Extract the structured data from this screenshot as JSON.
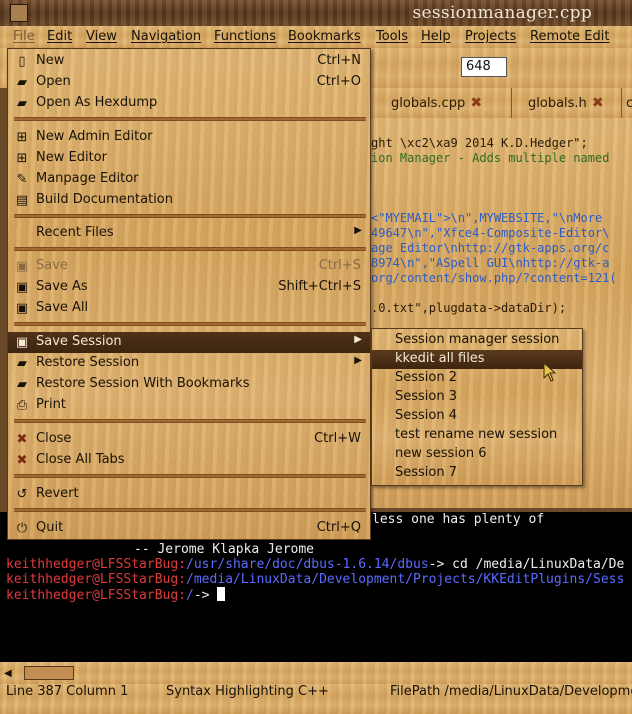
{
  "window": {
    "title": "sessionmanager.cpp"
  },
  "menubar": {
    "items": [
      "File",
      "Edit",
      "View",
      "Navigation",
      "Functions",
      "Bookmarks",
      "Tools",
      "Help",
      "Projects",
      "Remote Edit"
    ]
  },
  "toolbar": {
    "line_number": "648"
  },
  "tabs": [
    {
      "label": "globals.cpp"
    },
    {
      "label": "globals.h"
    },
    {
      "label": "c"
    }
  ],
  "editor": {
    "lines": [
      {
        "text": "ght \\xc2\\xa9 2014 K.D.Hedger\";",
        "kind": "def"
      },
      {
        "text": "ion Manager - Adds multiple named",
        "kind": "com"
      },
      {
        "text": "<\"MYEMAIL\">\\n\",MYWEBSITE,\"\\nMore",
        "kind": "str"
      },
      {
        "text": "49647\\n\",\"Xfce4-Composite-Editor\\",
        "kind": "str"
      },
      {
        "text": "age Editor\\nhttp://gtk-apps.org/c",
        "kind": "str"
      },
      {
        "text": "8974\\n\",\"ASpell GUI\\nhttp://gtk-a",
        "kind": "str"
      },
      {
        "text": "org/content/show.php/?content=121(",
        "kind": "str"
      },
      {
        "text": ".0.txt\",plugdata->dataDir);",
        "kind": "def"
      }
    ]
  },
  "file_menu": {
    "items": [
      {
        "label": "New",
        "accel": "Ctrl+N",
        "icon": "new-document-icon",
        "glyph": "▯"
      },
      {
        "label": "Open",
        "accel": "Ctrl+O",
        "icon": "open-folder-icon",
        "glyph": "▰"
      },
      {
        "label": "Open As Hexdump",
        "accel": "",
        "icon": "open-folder-icon",
        "glyph": "▰"
      },
      {
        "label": "New Admin Editor",
        "accel": "",
        "icon": "admin-editor-icon",
        "glyph": "⊞"
      },
      {
        "label": "New Editor",
        "accel": "",
        "icon": "editor-icon",
        "glyph": "⊞"
      },
      {
        "label": "Manpage Editor",
        "accel": "",
        "icon": "manpage-editor-icon",
        "glyph": "✎"
      },
      {
        "label": "Build Documentation",
        "accel": "",
        "icon": "documentation-icon",
        "glyph": "▤"
      },
      {
        "label": "Recent Files",
        "accel": "",
        "icon": "",
        "glyph": ""
      },
      {
        "label": "Save",
        "accel": "Ctrl+S",
        "icon": "save-icon",
        "glyph": "▣"
      },
      {
        "label": "Save As",
        "accel": "Shift+Ctrl+S",
        "icon": "save-as-icon",
        "glyph": "▣"
      },
      {
        "label": "Save All",
        "accel": "",
        "icon": "save-all-icon",
        "glyph": "▣"
      },
      {
        "label": "Save Session",
        "accel": "",
        "icon": "save-session-icon",
        "glyph": "▣"
      },
      {
        "label": "Restore Session",
        "accel": "",
        "icon": "restore-session-icon",
        "glyph": "▰"
      },
      {
        "label": "Restore Session With Bookmarks",
        "accel": "",
        "icon": "restore-bookmarks-icon",
        "glyph": "▰"
      },
      {
        "label": "Print",
        "accel": "",
        "icon": "print-icon",
        "glyph": "⎙"
      },
      {
        "label": "Close",
        "accel": "Ctrl+W",
        "icon": "close-icon",
        "glyph": "✖"
      },
      {
        "label": "Close All Tabs",
        "accel": "",
        "icon": "close-all-icon",
        "glyph": "✖"
      },
      {
        "label": "Revert",
        "accel": "",
        "icon": "revert-icon",
        "glyph": "↺"
      },
      {
        "label": "Quit",
        "accel": "Ctrl+Q",
        "icon": "quit-icon",
        "glyph": "⏻"
      }
    ]
  },
  "session_submenu": {
    "items": [
      "Session manager session",
      "kkedit all files",
      "Session 2",
      "Session 3",
      "Session 4",
      "test rename new session",
      "new session 6",
      "Session 7"
    ],
    "selected": "kkedit all files"
  },
  "terminal": {
    "lines": [
      {
        "user": "",
        "path": "",
        "rest": "less one has plenty of"
      },
      {
        "user": "",
        "path": "",
        "rest": "-- Jerome Klapka Jerome"
      },
      {
        "user": "keithhedger@LFSStarBug",
        "path": "/usr/share/doc/dbus-1.6.14/dbus",
        "rest": "-> cd /media/LinuxData/De"
      },
      {
        "user": "keithhedger@LFSStarBug",
        "path": "/media/LinuxData/Development/Projects/KKEditPlugins/Sess",
        "rest": ""
      },
      {
        "user": "keithhedger@LFSStarBug",
        "path": "/",
        "rest": "-> "
      }
    ]
  },
  "statusbar": {
    "position": "Line 387 Column 1",
    "syntax": "Syntax Highlighting C++",
    "filepath": "FilePath /media/LinuxData/Developme"
  }
}
